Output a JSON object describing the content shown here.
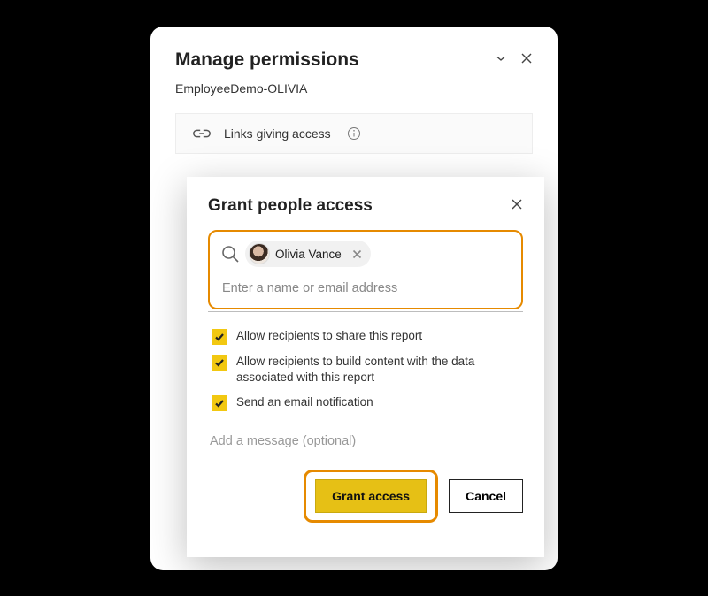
{
  "mainPanel": {
    "title": "Manage permissions",
    "subtitle": "EmployeeDemo-OLIVIA",
    "linksStrip": "Links giving access"
  },
  "dialog": {
    "title": "Grant people access",
    "selectedPerson": "Olivia Vance",
    "nameInputPlaceholder": "Enter a name or email address",
    "options": {
      "allowShare": "Allow recipients to share this report",
      "allowBuild": "Allow recipients to build content with the data associated with this report",
      "emailNotify": "Send an email notification"
    },
    "messagePlaceholder": "Add a message (optional)",
    "buttons": {
      "grant": "Grant access",
      "cancel": "Cancel"
    }
  }
}
